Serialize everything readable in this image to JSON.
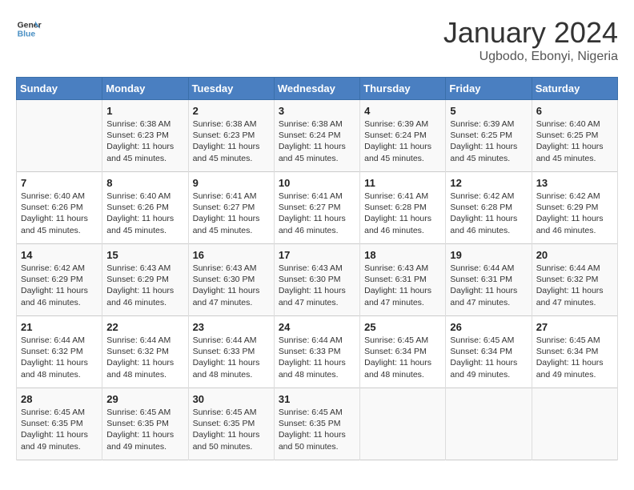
{
  "header": {
    "logo_general": "General",
    "logo_blue": "Blue",
    "title": "January 2024",
    "subtitle": "Ugbodo, Ebonyi, Nigeria"
  },
  "days_of_week": [
    "Sunday",
    "Monday",
    "Tuesday",
    "Wednesday",
    "Thursday",
    "Friday",
    "Saturday"
  ],
  "weeks": [
    [
      {
        "day": "",
        "info": ""
      },
      {
        "day": "1",
        "info": "Sunrise: 6:38 AM\nSunset: 6:23 PM\nDaylight: 11 hours and 45 minutes."
      },
      {
        "day": "2",
        "info": "Sunrise: 6:38 AM\nSunset: 6:23 PM\nDaylight: 11 hours and 45 minutes."
      },
      {
        "day": "3",
        "info": "Sunrise: 6:38 AM\nSunset: 6:24 PM\nDaylight: 11 hours and 45 minutes."
      },
      {
        "day": "4",
        "info": "Sunrise: 6:39 AM\nSunset: 6:24 PM\nDaylight: 11 hours and 45 minutes."
      },
      {
        "day": "5",
        "info": "Sunrise: 6:39 AM\nSunset: 6:25 PM\nDaylight: 11 hours and 45 minutes."
      },
      {
        "day": "6",
        "info": "Sunrise: 6:40 AM\nSunset: 6:25 PM\nDaylight: 11 hours and 45 minutes."
      }
    ],
    [
      {
        "day": "7",
        "info": "Sunrise: 6:40 AM\nSunset: 6:26 PM\nDaylight: 11 hours and 45 minutes."
      },
      {
        "day": "8",
        "info": "Sunrise: 6:40 AM\nSunset: 6:26 PM\nDaylight: 11 hours and 45 minutes."
      },
      {
        "day": "9",
        "info": "Sunrise: 6:41 AM\nSunset: 6:27 PM\nDaylight: 11 hours and 45 minutes."
      },
      {
        "day": "10",
        "info": "Sunrise: 6:41 AM\nSunset: 6:27 PM\nDaylight: 11 hours and 46 minutes."
      },
      {
        "day": "11",
        "info": "Sunrise: 6:41 AM\nSunset: 6:28 PM\nDaylight: 11 hours and 46 minutes."
      },
      {
        "day": "12",
        "info": "Sunrise: 6:42 AM\nSunset: 6:28 PM\nDaylight: 11 hours and 46 minutes."
      },
      {
        "day": "13",
        "info": "Sunrise: 6:42 AM\nSunset: 6:29 PM\nDaylight: 11 hours and 46 minutes."
      }
    ],
    [
      {
        "day": "14",
        "info": "Sunrise: 6:42 AM\nSunset: 6:29 PM\nDaylight: 11 hours and 46 minutes."
      },
      {
        "day": "15",
        "info": "Sunrise: 6:43 AM\nSunset: 6:29 PM\nDaylight: 11 hours and 46 minutes."
      },
      {
        "day": "16",
        "info": "Sunrise: 6:43 AM\nSunset: 6:30 PM\nDaylight: 11 hours and 47 minutes."
      },
      {
        "day": "17",
        "info": "Sunrise: 6:43 AM\nSunset: 6:30 PM\nDaylight: 11 hours and 47 minutes."
      },
      {
        "day": "18",
        "info": "Sunrise: 6:43 AM\nSunset: 6:31 PM\nDaylight: 11 hours and 47 minutes."
      },
      {
        "day": "19",
        "info": "Sunrise: 6:44 AM\nSunset: 6:31 PM\nDaylight: 11 hours and 47 minutes."
      },
      {
        "day": "20",
        "info": "Sunrise: 6:44 AM\nSunset: 6:32 PM\nDaylight: 11 hours and 47 minutes."
      }
    ],
    [
      {
        "day": "21",
        "info": "Sunrise: 6:44 AM\nSunset: 6:32 PM\nDaylight: 11 hours and 48 minutes."
      },
      {
        "day": "22",
        "info": "Sunrise: 6:44 AM\nSunset: 6:32 PM\nDaylight: 11 hours and 48 minutes."
      },
      {
        "day": "23",
        "info": "Sunrise: 6:44 AM\nSunset: 6:33 PM\nDaylight: 11 hours and 48 minutes."
      },
      {
        "day": "24",
        "info": "Sunrise: 6:44 AM\nSunset: 6:33 PM\nDaylight: 11 hours and 48 minutes."
      },
      {
        "day": "25",
        "info": "Sunrise: 6:45 AM\nSunset: 6:34 PM\nDaylight: 11 hours and 48 minutes."
      },
      {
        "day": "26",
        "info": "Sunrise: 6:45 AM\nSunset: 6:34 PM\nDaylight: 11 hours and 49 minutes."
      },
      {
        "day": "27",
        "info": "Sunrise: 6:45 AM\nSunset: 6:34 PM\nDaylight: 11 hours and 49 minutes."
      }
    ],
    [
      {
        "day": "28",
        "info": "Sunrise: 6:45 AM\nSunset: 6:35 PM\nDaylight: 11 hours and 49 minutes."
      },
      {
        "day": "29",
        "info": "Sunrise: 6:45 AM\nSunset: 6:35 PM\nDaylight: 11 hours and 49 minutes."
      },
      {
        "day": "30",
        "info": "Sunrise: 6:45 AM\nSunset: 6:35 PM\nDaylight: 11 hours and 50 minutes."
      },
      {
        "day": "31",
        "info": "Sunrise: 6:45 AM\nSunset: 6:35 PM\nDaylight: 11 hours and 50 minutes."
      },
      {
        "day": "",
        "info": ""
      },
      {
        "day": "",
        "info": ""
      },
      {
        "day": "",
        "info": ""
      }
    ]
  ]
}
